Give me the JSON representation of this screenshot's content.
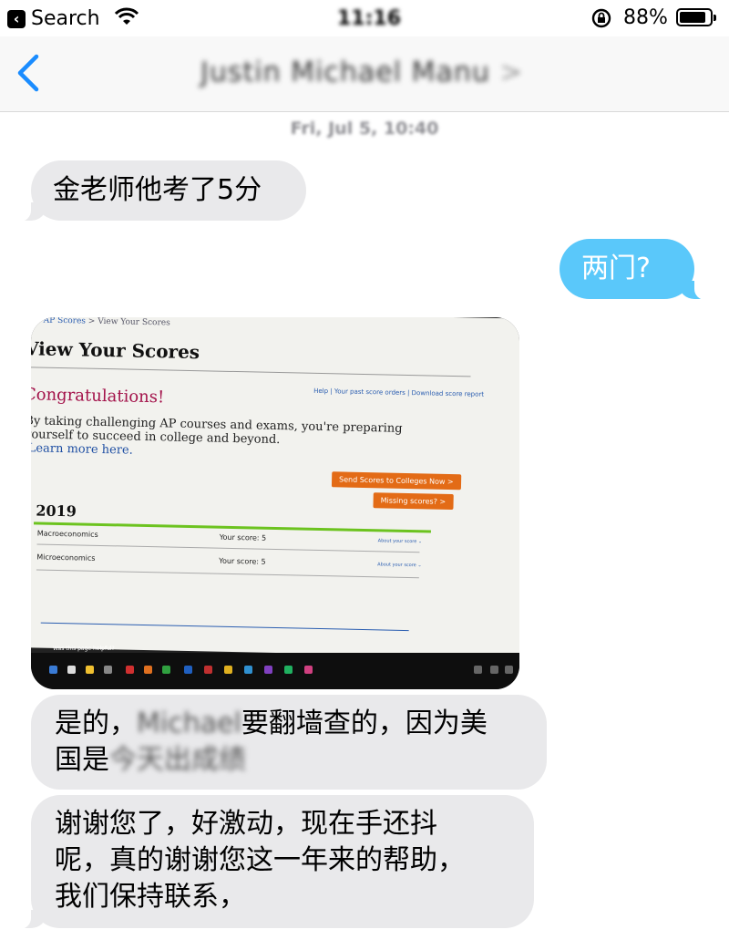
{
  "status_bar": {
    "back_app_label": "Search",
    "time": "11:16",
    "battery_percent": "88%",
    "battery_level": 0.88,
    "icons": [
      "back-app-icon",
      "wifi-icon",
      "rotation-lock-icon",
      "battery-icon"
    ]
  },
  "nav": {
    "contact_name": "Justin Michael Manu",
    "contact_chevron": ">",
    "icons": [
      "chevron-left-icon"
    ]
  },
  "conversation": {
    "timestamp": "Fri, Jul 5, 10:40",
    "messages": [
      {
        "direction": "incoming",
        "text": "金老师他考了5分"
      },
      {
        "direction": "outgoing",
        "text": "两门?"
      },
      {
        "direction": "incoming",
        "type": "photo"
      },
      {
        "direction": "incoming",
        "text_parts": [
          "是的，",
          "Michael",
          "要翻墙查的，因为美",
          "国是",
          "今天出成绩"
        ]
      },
      {
        "direction": "incoming",
        "lines": [
          "谢谢您了，好激动，现在手还抖",
          "呢，真的谢谢您这一年来的帮助，",
          "我们保持联系，"
        ]
      }
    ]
  },
  "photo_screen": {
    "breadcrumb_link": "AP Scores",
    "breadcrumb_sep": " > ",
    "breadcrumb_current": "View Your Scores",
    "title": "View Your Scores",
    "links": [
      "Help",
      "|",
      "Your past score orders",
      "|",
      "Download score report"
    ],
    "congrats": "Congratulations!",
    "body": "By taking challenging AP courses and exams, you're preparing yourself to succeed in college and beyond.",
    "learn_more": "Learn more here.",
    "send_button": "Send Scores to Colleges Now >",
    "missing_button": "Missing scores? >",
    "year": "2019",
    "rows": [
      {
        "subject": "Macroeconomics",
        "score_label": "Your score: 5",
        "about": "About your score ⌄"
      },
      {
        "subject": "Microeconomics",
        "score_label": "Your score: 5",
        "about": "About your score ⌄"
      }
    ],
    "helpful": "Was this page helpful?"
  }
}
